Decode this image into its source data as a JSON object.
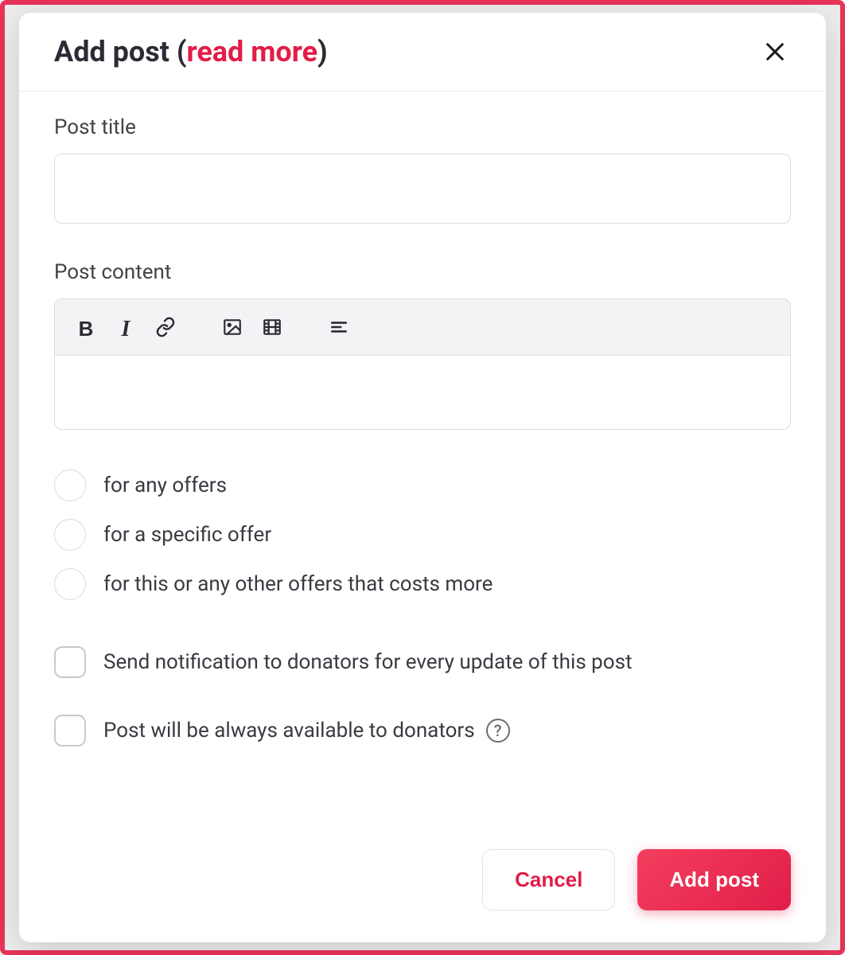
{
  "modal": {
    "title_prefix": "Add post ",
    "title_paren_open": "(",
    "title_link": "read more",
    "title_paren_close": ")"
  },
  "fields": {
    "title_label": "Post title",
    "title_value": "",
    "content_label": "Post content",
    "content_value": ""
  },
  "toolbar": {
    "bold": "B",
    "italic": "I"
  },
  "radios": {
    "opt1": "for any offers",
    "opt2": "for a specific offer",
    "opt3": "for this or any other offers that costs more"
  },
  "checks": {
    "notify": "Send notification to donators for every update of this post",
    "always": "Post will be always available to donators",
    "help_glyph": "?"
  },
  "footer": {
    "cancel": "Cancel",
    "submit": "Add post"
  }
}
